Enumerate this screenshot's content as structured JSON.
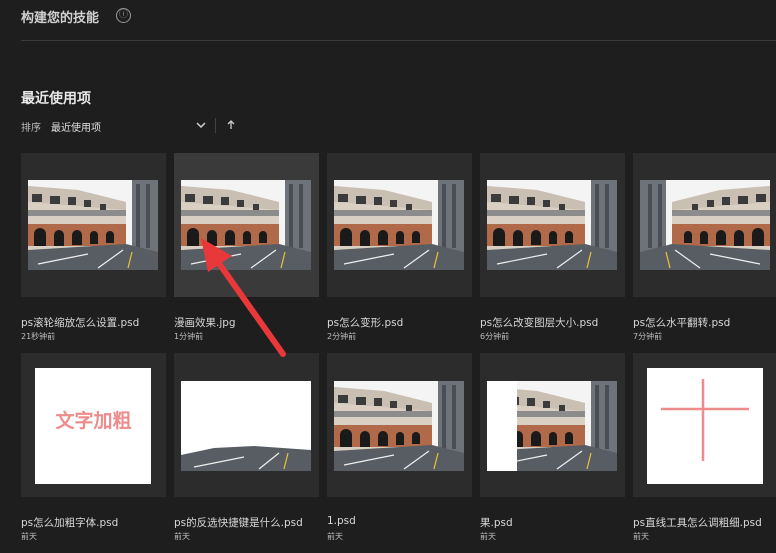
{
  "header": {
    "title": "构建您的技能",
    "info_icon": "ⓘ"
  },
  "recent": {
    "title": "最近使用项",
    "sort_label": "排序",
    "sort_value": "最近使用项",
    "sort_dir_icon": "↑"
  },
  "files": [
    {
      "name": "ps滚轮缩放怎么设置.psd",
      "time": "21秒钟前"
    },
    {
      "name": "漫画效果.jpg",
      "time": "1分钟前"
    },
    {
      "name": "ps怎么变形.psd",
      "time": "2分钟前"
    },
    {
      "name": "ps怎么改变图层大小.psd",
      "time": "6分钟前"
    },
    {
      "name": "ps怎么水平翻转.psd",
      "time": "7分钟前"
    },
    {
      "name": "ps怎么加粗字体.psd",
      "time": "前天",
      "thumb_text": "文字加粗"
    },
    {
      "name": "ps的反选快捷键是什么.psd",
      "time": "前天"
    },
    {
      "name": "1.psd",
      "time": "前天"
    },
    {
      "name": "果.psd",
      "time": "前天"
    },
    {
      "name": "ps直线工具怎么调粗细.psd",
      "time": "前天"
    }
  ],
  "colors": {
    "background": "#1e1e1e",
    "card": "#2c2c2c",
    "annotation_arrow": "#e8383a",
    "pink_accent": "#ee8c8c"
  }
}
